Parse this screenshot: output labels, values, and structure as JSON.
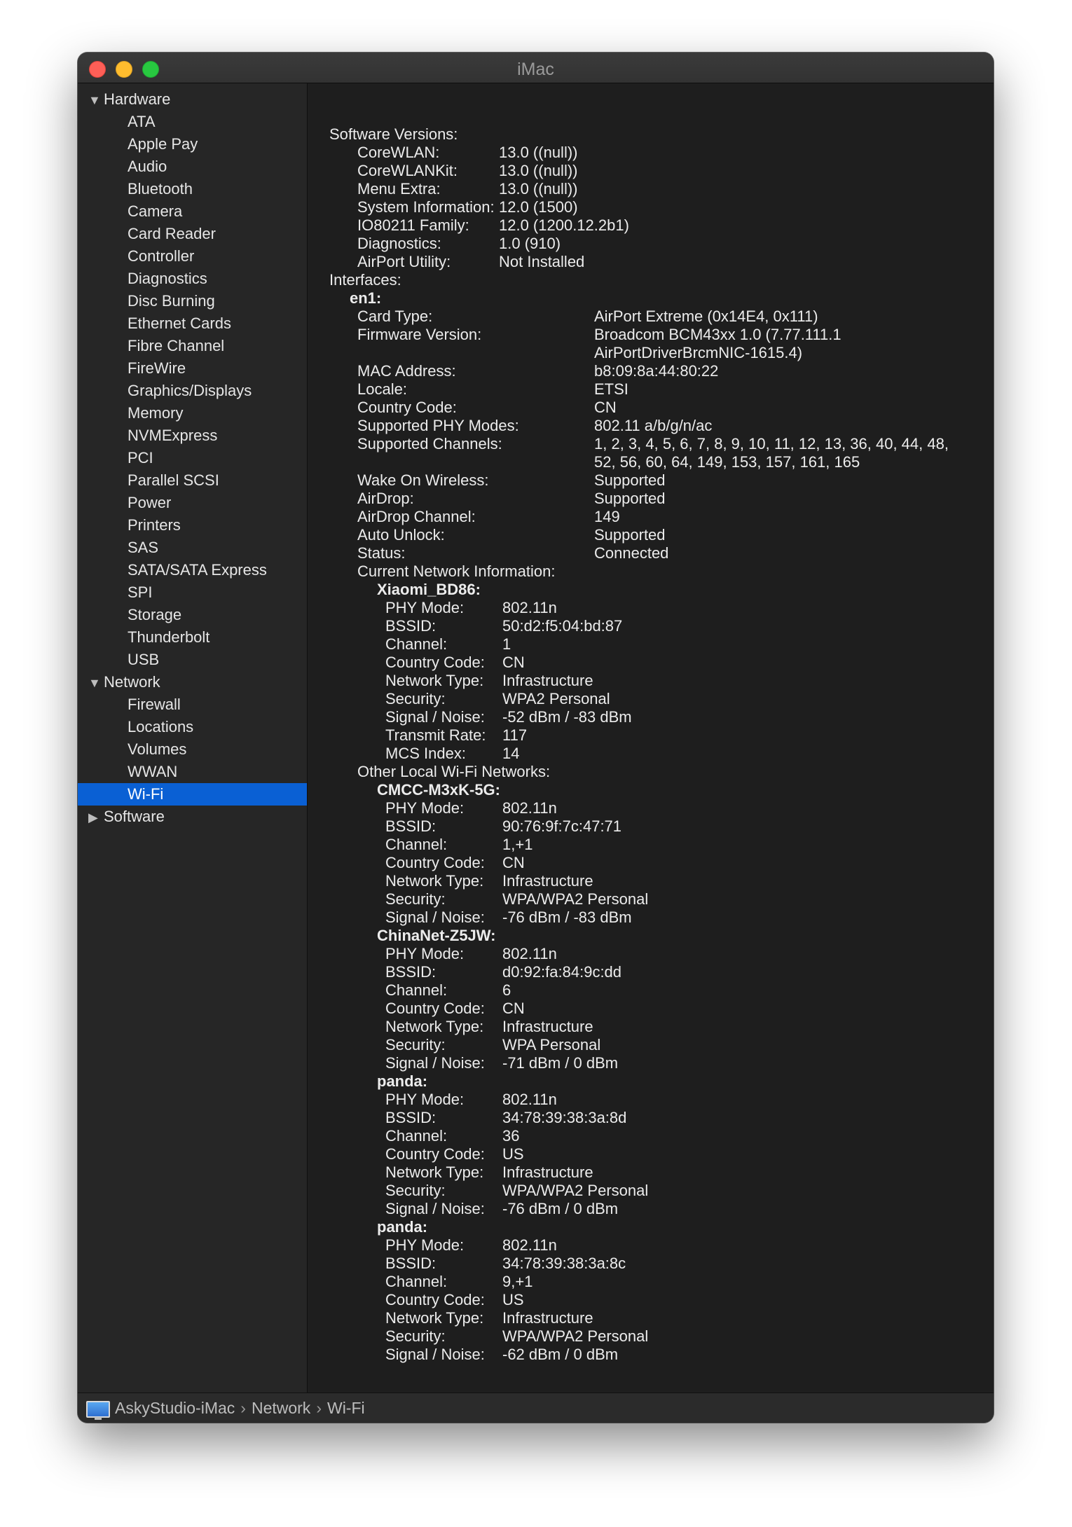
{
  "window": {
    "title": "iMac"
  },
  "sidebar": {
    "groups": [
      {
        "label": "Hardware",
        "expanded": true,
        "items": [
          "ATA",
          "Apple Pay",
          "Audio",
          "Bluetooth",
          "Camera",
          "Card Reader",
          "Controller",
          "Diagnostics",
          "Disc Burning",
          "Ethernet Cards",
          "Fibre Channel",
          "FireWire",
          "Graphics/Displays",
          "Memory",
          "NVMExpress",
          "PCI",
          "Parallel SCSI",
          "Power",
          "Printers",
          "SAS",
          "SATA/SATA Express",
          "SPI",
          "Storage",
          "Thunderbolt",
          "USB"
        ]
      },
      {
        "label": "Network",
        "expanded": true,
        "items": [
          "Firewall",
          "Locations",
          "Volumes",
          "WWAN",
          "Wi-Fi"
        ]
      },
      {
        "label": "Software",
        "expanded": false,
        "items": []
      }
    ],
    "selected": "Wi-Fi"
  },
  "content": {
    "software_versions": {
      "label": "Software Versions:",
      "rows": [
        [
          "CoreWLAN:",
          "13.0 ((null))"
        ],
        [
          "CoreWLANKit:",
          "13.0 ((null))"
        ],
        [
          "Menu Extra:",
          "13.0 ((null))"
        ],
        [
          "System Information:",
          "12.0 (1500)"
        ],
        [
          "IO80211 Family:",
          "12.0 (1200.12.2b1)"
        ],
        [
          "Diagnostics:",
          "1.0 (910)"
        ],
        [
          "AirPort Utility:",
          "Not Installed"
        ]
      ]
    },
    "interfaces_label": "Interfaces:",
    "interface_name": "en1:",
    "interface_rows": [
      [
        "Card Type:",
        "AirPort Extreme  (0x14E4, 0x111)"
      ],
      [
        "Firmware Version:",
        "Broadcom BCM43xx 1.0 (7.77.111.1",
        "AirPortDriverBrcmNIC-1615.4)"
      ],
      [
        "MAC Address:",
        "b8:09:8a:44:80:22"
      ],
      [
        "Locale:",
        "ETSI"
      ],
      [
        "Country Code:",
        "CN"
      ],
      [
        "Supported PHY Modes:",
        "802.11 a/b/g/n/ac"
      ],
      [
        "Supported Channels:",
        "1, 2, 3, 4, 5, 6, 7, 8, 9, 10, 11, 12, 13, 36, 40, 44, 48,",
        "52, 56, 60, 64, 149, 153, 157, 161, 165"
      ],
      [
        "Wake On Wireless:",
        "Supported"
      ],
      [
        "AirDrop:",
        "Supported"
      ],
      [
        "AirDrop Channel:",
        "149"
      ],
      [
        "Auto Unlock:",
        "Supported"
      ],
      [
        "Status:",
        "Connected"
      ]
    ],
    "current_network_label": "Current Network Information:",
    "current_network": {
      "name": "Xiaomi_BD86:",
      "rows": [
        [
          "PHY Mode:",
          "802.11n"
        ],
        [
          "BSSID:",
          "50:d2:f5:04:bd:87"
        ],
        [
          "Channel:",
          "1"
        ],
        [
          "Country Code:",
          "CN"
        ],
        [
          "Network Type:",
          "Infrastructure"
        ],
        [
          "Security:",
          "WPA2 Personal"
        ],
        [
          "Signal / Noise:",
          "-52 dBm / -83 dBm"
        ],
        [
          "Transmit Rate:",
          "117"
        ],
        [
          "MCS Index:",
          "14"
        ]
      ]
    },
    "other_networks_label": "Other Local Wi-Fi Networks:",
    "other_networks": [
      {
        "name": "CMCC-M3xK-5G:",
        "rows": [
          [
            "PHY Mode:",
            "802.11n"
          ],
          [
            "BSSID:",
            "90:76:9f:7c:47:71"
          ],
          [
            "Channel:",
            "1,+1"
          ],
          [
            "Country Code:",
            "CN"
          ],
          [
            "Network Type:",
            "Infrastructure"
          ],
          [
            "Security:",
            "WPA/WPA2 Personal"
          ],
          [
            "Signal / Noise:",
            "-76 dBm / -83 dBm"
          ]
        ]
      },
      {
        "name": "ChinaNet-Z5JW:",
        "rows": [
          [
            "PHY Mode:",
            "802.11n"
          ],
          [
            "BSSID:",
            "d0:92:fa:84:9c:dd"
          ],
          [
            "Channel:",
            "6"
          ],
          [
            "Country Code:",
            "CN"
          ],
          [
            "Network Type:",
            "Infrastructure"
          ],
          [
            "Security:",
            "WPA Personal"
          ],
          [
            "Signal / Noise:",
            "-71 dBm / 0 dBm"
          ]
        ]
      },
      {
        "name": "panda:",
        "rows": [
          [
            "PHY Mode:",
            "802.11n"
          ],
          [
            "BSSID:",
            "34:78:39:38:3a:8d"
          ],
          [
            "Channel:",
            "36"
          ],
          [
            "Country Code:",
            "US"
          ],
          [
            "Network Type:",
            "Infrastructure"
          ],
          [
            "Security:",
            "WPA/WPA2 Personal"
          ],
          [
            "Signal / Noise:",
            "-76 dBm / 0 dBm"
          ]
        ]
      },
      {
        "name": "panda:",
        "rows": [
          [
            "PHY Mode:",
            "802.11n"
          ],
          [
            "BSSID:",
            "34:78:39:38:3a:8c"
          ],
          [
            "Channel:",
            "9,+1"
          ],
          [
            "Country Code:",
            "US"
          ],
          [
            "Network Type:",
            "Infrastructure"
          ],
          [
            "Security:",
            "WPA/WPA2 Personal"
          ],
          [
            "Signal / Noise:",
            "-62 dBm / 0 dBm"
          ]
        ]
      }
    ]
  },
  "statusbar": {
    "crumbs": [
      "AskyStudio-iMac",
      "Network",
      "Wi-Fi"
    ],
    "separator": "›"
  },
  "colors": {
    "selection": "#0a60d4",
    "background": "#1e1e1e",
    "sidebar": "#262626"
  }
}
